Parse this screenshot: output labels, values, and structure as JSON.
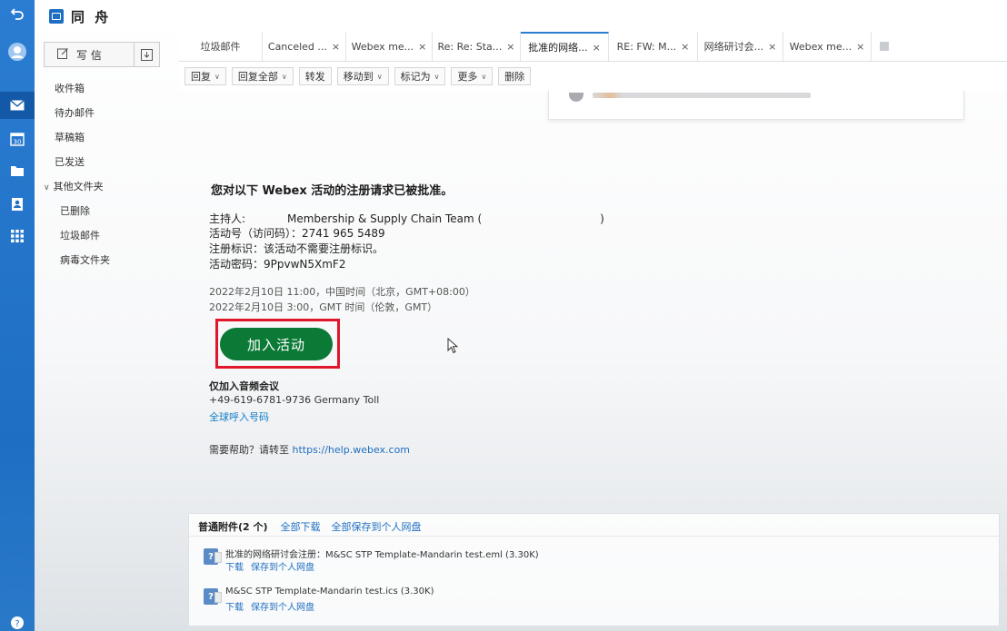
{
  "app": {
    "title": "同 舟"
  },
  "compose": {
    "label": "写 信"
  },
  "folders": {
    "inbox": "收件箱",
    "todo": "待办邮件",
    "drafts": "草稿箱",
    "sent": "已发送",
    "other_group": "其他文件夹",
    "deleted": "已删除",
    "spam": "垃圾邮件",
    "virus": "病毒文件夹"
  },
  "tabs": [
    {
      "label": "垃圾邮件",
      "closable": false
    },
    {
      "label": "Canceled ...",
      "closable": true
    },
    {
      "label": "Webex me...",
      "closable": true
    },
    {
      "label": "Re: Re: Sta...",
      "closable": true
    },
    {
      "label": "批准的网络...",
      "closable": true,
      "active": true
    },
    {
      "label": "RE: FW: M...",
      "closable": true
    },
    {
      "label": "网络研讨会...",
      "closable": true
    },
    {
      "label": "Webex me...",
      "closable": true
    }
  ],
  "tab_close_glyph": "×",
  "toolbar": {
    "reply": "回复",
    "reply_all": "回复全部",
    "forward": "转发",
    "move_to": "移动到",
    "mark_as": "标记为",
    "more": "更多",
    "delete": "删除"
  },
  "message": {
    "headline": "您对以下 Webex 活动的注册请求已被批准。",
    "host_label": "主持人:",
    "host_value": "Membership & Supply Chain Team (",
    "host_close": ")",
    "event_number": "活动号（访问码）：2741 965 5489",
    "reg_id": "注册标识：该活动不需要注册标识。",
    "password": "活动密码：9PpvwN5XmF2",
    "time_beijing": "2022年2月10日 11:00，中国时间（北京，GMT+08:00）",
    "time_london": "2022年2月10日 3:00，GMT 时间（伦敦，GMT）",
    "join_button": "加入活动",
    "audio_title": "仅加入音频会议",
    "audio_number": "+49-619-6781-9736 Germany Toll",
    "global_numbers": "全球呼入号码",
    "help_prefix": "需要帮助？请转至",
    "help_link": "https://help.webex.com"
  },
  "attachments": {
    "label": "普通附件(2 个)",
    "download_all": "全部下载",
    "save_all": "全部保存到个人网盘",
    "files": [
      {
        "name": "批准的网络研讨会注册：M&SC STP Template-Mandarin test.eml  (3.30K)",
        "download": "下载",
        "save": "保存到个人网盘"
      },
      {
        "name": "M&SC STP Template-Mandarin test.ics  (3.30K)",
        "download": "下载",
        "save": "保存到个人网盘"
      }
    ]
  },
  "colors": {
    "rail": "#1e6fc4",
    "join_button": "#0c7a37",
    "highlight_box": "#e0162b",
    "link": "#1f6fc0"
  }
}
